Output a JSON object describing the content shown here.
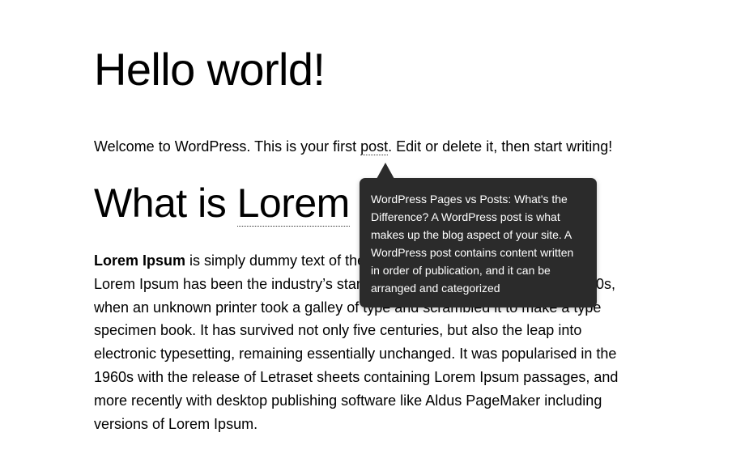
{
  "post": {
    "title": "Hello world!",
    "intro": {
      "before": "Welcome to WordPress. This is your first ",
      "term": "post",
      "after": ". Edit or delete it, then start writing!"
    },
    "heading": {
      "before": "What is ",
      "term": "Lorem"
    },
    "body": {
      "bold": "Lorem Ipsum",
      "text": " is simply dummy text of the printing and typesetting industry. Lorem Ipsum has been the industry’s standard dummy text ever since the 1500s, when an unknown printer took a galley of type and scrambled it to make a type specimen book. It has survived not only five centuries, but also the leap into electronic typesetting, remaining essentially unchanged. It was popularised in the 1960s with the release of Letraset sheets containing Lorem Ipsum passages, and more recently with desktop publishing software like Aldus PageMaker including versions of Lorem Ipsum."
    }
  },
  "tooltip": {
    "text": "WordPress Pages vs Posts: What's the Difference? A WordPress post is what makes up the blog aspect of your site. A WordPress post contains content written in order of publication, and it can be arranged and categorized"
  },
  "colors": {
    "tooltip_background": "#2b2b2b",
    "tooltip_text": "#ffffff",
    "page_background": "#ffffff"
  }
}
